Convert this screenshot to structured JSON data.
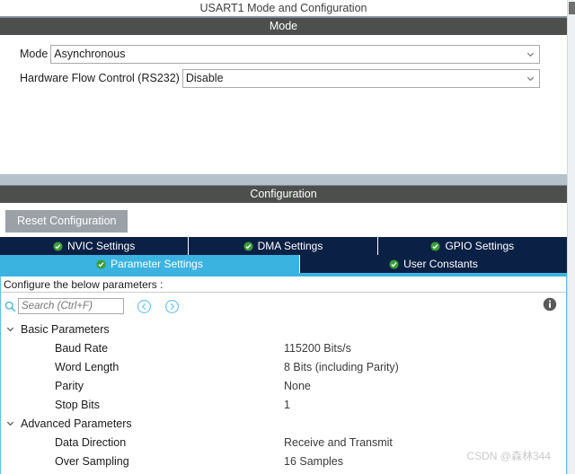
{
  "window": {
    "title": "USART1 Mode and Configuration"
  },
  "mode_section": {
    "header": "Mode",
    "fields": [
      {
        "label": "Mode",
        "value": "Asynchronous"
      },
      {
        "label": "Hardware Flow Control (RS232)",
        "value": "Disable"
      }
    ]
  },
  "configuration_section": {
    "header": "Configuration",
    "reset_button": "Reset Configuration",
    "tabs_row1": [
      {
        "label": "NVIC Settings",
        "selected": false
      },
      {
        "label": "DMA Settings",
        "selected": false
      },
      {
        "label": "GPIO Settings",
        "selected": false
      }
    ],
    "tabs_row2": [
      {
        "label": "Parameter Settings",
        "selected": true
      },
      {
        "label": "User Constants",
        "selected": false
      }
    ]
  },
  "parameter_panel": {
    "note": "Configure the below parameters :",
    "search_placeholder": "Search (Ctrl+F)",
    "groups": [
      {
        "label": "Basic Parameters",
        "expanded": true,
        "rows": [
          {
            "name": "Baud Rate",
            "value": "115200 Bits/s"
          },
          {
            "name": "Word Length",
            "value": "8 Bits (including Parity)"
          },
          {
            "name": "Parity",
            "value": "None"
          },
          {
            "name": "Stop Bits",
            "value": "1"
          }
        ]
      },
      {
        "label": "Advanced Parameters",
        "expanded": true,
        "rows": [
          {
            "name": "Data Direction",
            "value": "Receive and Transmit"
          },
          {
            "name": "Over Sampling",
            "value": "16 Samples"
          }
        ]
      }
    ]
  },
  "watermark": {
    "text": "CSDN @森林344"
  },
  "colors": {
    "section_bar": "#4d4f4d",
    "tab_bg": "#0b2045",
    "tab_selected": "#3bb3e0",
    "band": "#b6c2cb",
    "reset_button": "#9aa1a7",
    "panel_border": "#5fc0e8",
    "check_green": "#3a9e34"
  }
}
